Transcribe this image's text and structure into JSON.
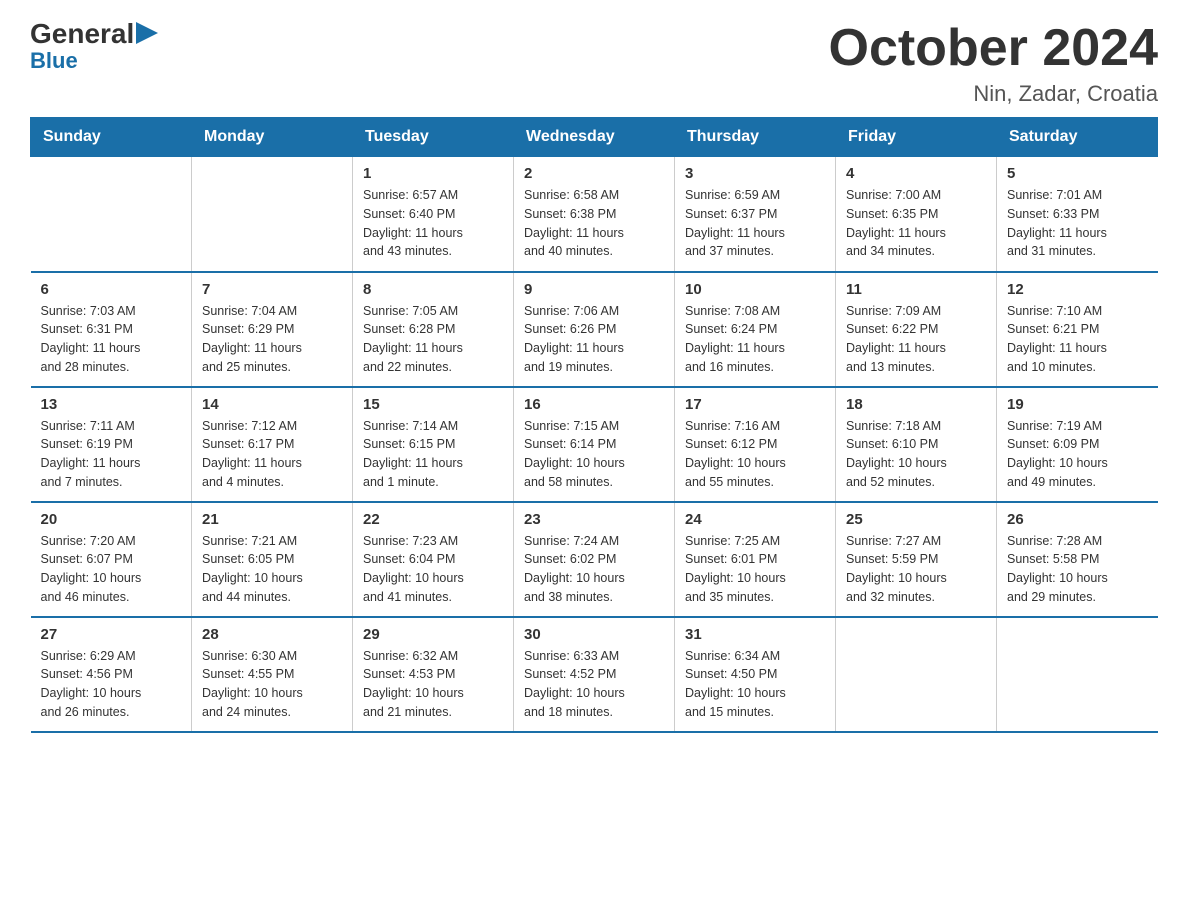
{
  "logo": {
    "general": "General",
    "blue": "Blue"
  },
  "title": {
    "month": "October 2024",
    "location": "Nin, Zadar, Croatia"
  },
  "weekdays": [
    "Sunday",
    "Monday",
    "Tuesday",
    "Wednesday",
    "Thursday",
    "Friday",
    "Saturday"
  ],
  "weeks": [
    [
      {
        "day": "",
        "info": ""
      },
      {
        "day": "",
        "info": ""
      },
      {
        "day": "1",
        "info": "Sunrise: 6:57 AM\nSunset: 6:40 PM\nDaylight: 11 hours\nand 43 minutes."
      },
      {
        "day": "2",
        "info": "Sunrise: 6:58 AM\nSunset: 6:38 PM\nDaylight: 11 hours\nand 40 minutes."
      },
      {
        "day": "3",
        "info": "Sunrise: 6:59 AM\nSunset: 6:37 PM\nDaylight: 11 hours\nand 37 minutes."
      },
      {
        "day": "4",
        "info": "Sunrise: 7:00 AM\nSunset: 6:35 PM\nDaylight: 11 hours\nand 34 minutes."
      },
      {
        "day": "5",
        "info": "Sunrise: 7:01 AM\nSunset: 6:33 PM\nDaylight: 11 hours\nand 31 minutes."
      }
    ],
    [
      {
        "day": "6",
        "info": "Sunrise: 7:03 AM\nSunset: 6:31 PM\nDaylight: 11 hours\nand 28 minutes."
      },
      {
        "day": "7",
        "info": "Sunrise: 7:04 AM\nSunset: 6:29 PM\nDaylight: 11 hours\nand 25 minutes."
      },
      {
        "day": "8",
        "info": "Sunrise: 7:05 AM\nSunset: 6:28 PM\nDaylight: 11 hours\nand 22 minutes."
      },
      {
        "day": "9",
        "info": "Sunrise: 7:06 AM\nSunset: 6:26 PM\nDaylight: 11 hours\nand 19 minutes."
      },
      {
        "day": "10",
        "info": "Sunrise: 7:08 AM\nSunset: 6:24 PM\nDaylight: 11 hours\nand 16 minutes."
      },
      {
        "day": "11",
        "info": "Sunrise: 7:09 AM\nSunset: 6:22 PM\nDaylight: 11 hours\nand 13 minutes."
      },
      {
        "day": "12",
        "info": "Sunrise: 7:10 AM\nSunset: 6:21 PM\nDaylight: 11 hours\nand 10 minutes."
      }
    ],
    [
      {
        "day": "13",
        "info": "Sunrise: 7:11 AM\nSunset: 6:19 PM\nDaylight: 11 hours\nand 7 minutes."
      },
      {
        "day": "14",
        "info": "Sunrise: 7:12 AM\nSunset: 6:17 PM\nDaylight: 11 hours\nand 4 minutes."
      },
      {
        "day": "15",
        "info": "Sunrise: 7:14 AM\nSunset: 6:15 PM\nDaylight: 11 hours\nand 1 minute."
      },
      {
        "day": "16",
        "info": "Sunrise: 7:15 AM\nSunset: 6:14 PM\nDaylight: 10 hours\nand 58 minutes."
      },
      {
        "day": "17",
        "info": "Sunrise: 7:16 AM\nSunset: 6:12 PM\nDaylight: 10 hours\nand 55 minutes."
      },
      {
        "day": "18",
        "info": "Sunrise: 7:18 AM\nSunset: 6:10 PM\nDaylight: 10 hours\nand 52 minutes."
      },
      {
        "day": "19",
        "info": "Sunrise: 7:19 AM\nSunset: 6:09 PM\nDaylight: 10 hours\nand 49 minutes."
      }
    ],
    [
      {
        "day": "20",
        "info": "Sunrise: 7:20 AM\nSunset: 6:07 PM\nDaylight: 10 hours\nand 46 minutes."
      },
      {
        "day": "21",
        "info": "Sunrise: 7:21 AM\nSunset: 6:05 PM\nDaylight: 10 hours\nand 44 minutes."
      },
      {
        "day": "22",
        "info": "Sunrise: 7:23 AM\nSunset: 6:04 PM\nDaylight: 10 hours\nand 41 minutes."
      },
      {
        "day": "23",
        "info": "Sunrise: 7:24 AM\nSunset: 6:02 PM\nDaylight: 10 hours\nand 38 minutes."
      },
      {
        "day": "24",
        "info": "Sunrise: 7:25 AM\nSunset: 6:01 PM\nDaylight: 10 hours\nand 35 minutes."
      },
      {
        "day": "25",
        "info": "Sunrise: 7:27 AM\nSunset: 5:59 PM\nDaylight: 10 hours\nand 32 minutes."
      },
      {
        "day": "26",
        "info": "Sunrise: 7:28 AM\nSunset: 5:58 PM\nDaylight: 10 hours\nand 29 minutes."
      }
    ],
    [
      {
        "day": "27",
        "info": "Sunrise: 6:29 AM\nSunset: 4:56 PM\nDaylight: 10 hours\nand 26 minutes."
      },
      {
        "day": "28",
        "info": "Sunrise: 6:30 AM\nSunset: 4:55 PM\nDaylight: 10 hours\nand 24 minutes."
      },
      {
        "day": "29",
        "info": "Sunrise: 6:32 AM\nSunset: 4:53 PM\nDaylight: 10 hours\nand 21 minutes."
      },
      {
        "day": "30",
        "info": "Sunrise: 6:33 AM\nSunset: 4:52 PM\nDaylight: 10 hours\nand 18 minutes."
      },
      {
        "day": "31",
        "info": "Sunrise: 6:34 AM\nSunset: 4:50 PM\nDaylight: 10 hours\nand 15 minutes."
      },
      {
        "day": "",
        "info": ""
      },
      {
        "day": "",
        "info": ""
      }
    ]
  ]
}
